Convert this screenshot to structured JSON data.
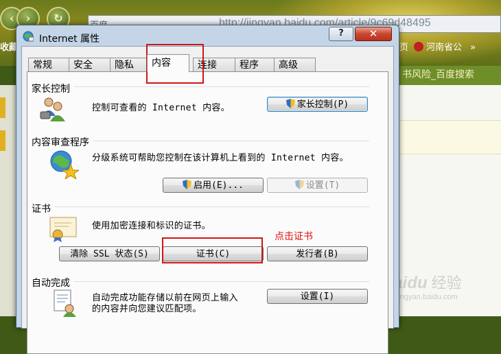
{
  "browser": {
    "address_prefix": "百度",
    "address_url": "http://jingyan.baidu.com/article/9c69d48495",
    "favorites_label": "收藏",
    "fav_right_1": "页",
    "fav_right_2": "河南省公",
    "fav_more": "»",
    "tab_title": "书风险_百度搜索",
    "watermark_brand": "Baidu",
    "watermark_jy": "经验",
    "watermark_url": "jingyan.baidu.com"
  },
  "dialog": {
    "title": "Internet 属性",
    "help_label": "?",
    "close_label": "✕",
    "tabs": [
      "常规",
      "安全",
      "隐私",
      "内容",
      "连接",
      "程序",
      "高级"
    ],
    "active_tab": "内容",
    "parental": {
      "title": "家长控制",
      "desc": "控制可查看的 Internet 内容。",
      "button": "家长控制(P)"
    },
    "advisor": {
      "title": "内容审查程序",
      "desc": "分级系统可帮助您控制在该计算机上看到的 Internet 内容。",
      "enable_button": "启用(E)...",
      "settings_button": "设置(T)"
    },
    "certs": {
      "title": "证书",
      "desc": "使用加密连接和标识的证书。",
      "clear_ssl_button": "清除 SSL 状态(S)",
      "cert_button": "证书(C)",
      "publisher_button": "发行者(B)"
    },
    "autocomplete": {
      "title": "自动完成",
      "desc_line1": "自动完成功能存储以前在网页上输入",
      "desc_line2": "的内容并向您建议匹配项。",
      "settings_button": "设置(I)"
    }
  },
  "annotation": {
    "text": "点击证书",
    "color": "#e01010"
  },
  "colors": {
    "highlight_red": "#d01515",
    "dialog_frame": "#c4d5e8",
    "panel_bg": "#fbfbfb"
  }
}
